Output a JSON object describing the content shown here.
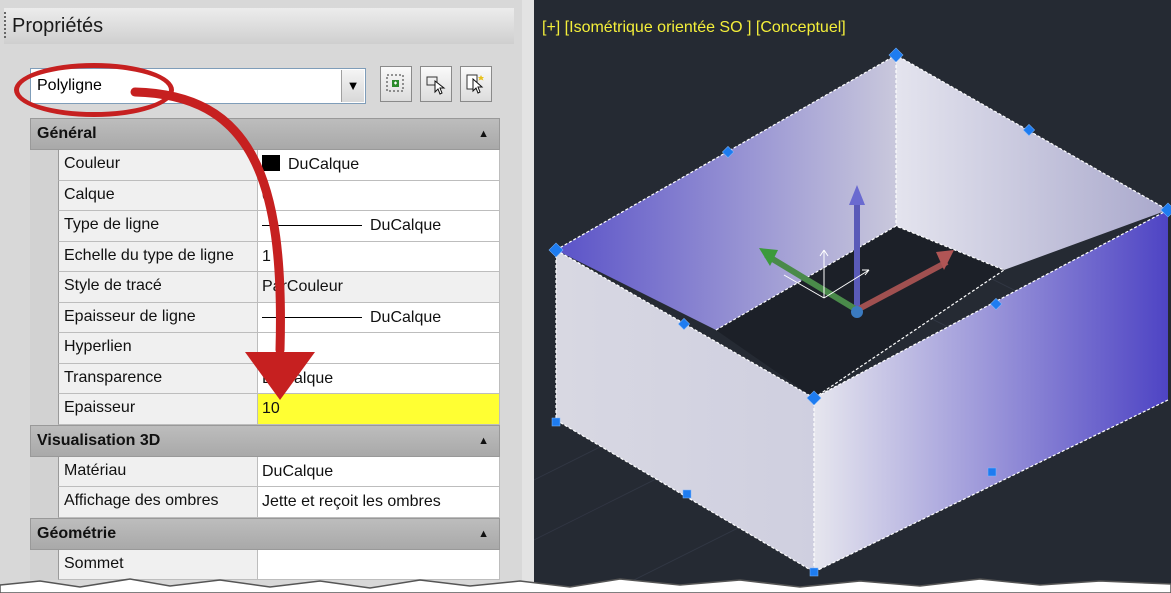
{
  "panel": {
    "title": "Propriétés",
    "selection": "Polyligne",
    "toolbar_icons": [
      "quick-select-icon",
      "select-objects-icon",
      "toggle-pickadd-icon"
    ]
  },
  "sections": [
    {
      "title": "Général",
      "rows": [
        {
          "label": "Couleur",
          "value": "DuCalque",
          "swatch": "#000000"
        },
        {
          "label": "Calque",
          "value": "0"
        },
        {
          "label": "Type de ligne",
          "value": "DuCalque",
          "linesample": true
        },
        {
          "label": "Echelle du type de ligne",
          "value": "1"
        },
        {
          "label": "Style de tracé",
          "value": "ParCouleur"
        },
        {
          "label": "Epaisseur de ligne",
          "value": "DuCalque",
          "linesample": true
        },
        {
          "label": "Hyperlien",
          "value": ""
        },
        {
          "label": "Transparence",
          "value": "DuCalque"
        },
        {
          "label": "Epaisseur",
          "value": "10",
          "highlight": true
        }
      ]
    },
    {
      "title": "Visualisation 3D",
      "rows": [
        {
          "label": "Matériau",
          "value": "DuCalque"
        },
        {
          "label": "Affichage des ombres",
          "value": "Jette et reçoit les ombres"
        }
      ]
    },
    {
      "title": "Géométrie",
      "rows": [
        {
          "label": "Sommet",
          "value": ""
        }
      ]
    }
  ],
  "viewport": {
    "caption": "[+] [Isométrique orientée SO ] [Conceptuel]",
    "background": "#252a33",
    "caption_color": "#f4ef3a",
    "grip_color": "#1e7cf0"
  },
  "annotation": {
    "color": "#c62020"
  }
}
